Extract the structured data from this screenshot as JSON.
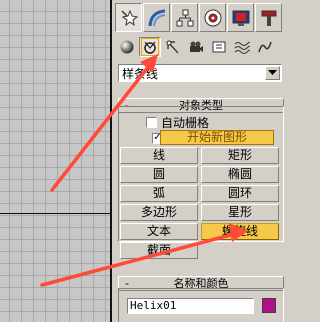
{
  "command_panel": {
    "tabs": [
      {
        "icon": "create-tab-icon",
        "active": true
      },
      {
        "icon": "modify-tab-icon",
        "active": false
      },
      {
        "icon": "hierarchy-tab-icon",
        "active": false
      },
      {
        "icon": "motion-tab-icon",
        "active": false
      },
      {
        "icon": "display-tab-icon",
        "active": false
      },
      {
        "icon": "utilities-tab-icon",
        "active": false
      }
    ],
    "subcategories": [
      {
        "icon": "geometry-icon",
        "active": false
      },
      {
        "icon": "shapes-icon",
        "active": true
      },
      {
        "icon": "lights-icon",
        "active": false
      },
      {
        "icon": "cameras-icon",
        "active": false
      },
      {
        "icon": "helpers-icon",
        "active": false
      },
      {
        "icon": "space-warps-icon",
        "active": false
      },
      {
        "icon": "systems-icon",
        "active": false
      }
    ],
    "category_value": "样条线"
  },
  "object_type": {
    "header": "对象类型",
    "collapse_symbol": "-",
    "auto_grid_label": "自动栅格",
    "auto_grid_checked": false,
    "start_new_shape_checked": true,
    "start_new_shape_checkmark": "✓",
    "start_new_shape_label": "开始新图形",
    "buttons": {
      "line": "线",
      "rectangle": "矩形",
      "circle": "圆",
      "ellipse": "椭圆",
      "arc": "弧",
      "donut": "圆环",
      "ngon": "多边形",
      "star": "星形",
      "text": "文本",
      "helix": "螺旋线",
      "section": "截面"
    },
    "selected": "helix"
  },
  "name_and_color": {
    "header": "名称和颜色",
    "collapse_symbol": "-",
    "name_value": "Helix01",
    "color": "#b0108a"
  },
  "colors": {
    "highlight": "#f6c94a",
    "annotation_arrow": "#ff4a3a"
  }
}
